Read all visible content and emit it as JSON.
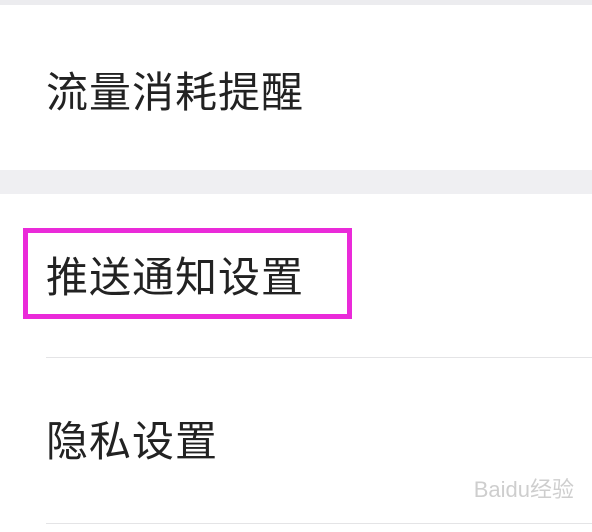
{
  "settings": {
    "items": [
      {
        "label": "流量消耗提醒"
      },
      {
        "label": "推送通知设置"
      },
      {
        "label": "隐私设置"
      }
    ]
  },
  "watermark": {
    "text": "Baidu经验"
  },
  "colors": {
    "highlight": "#ea2ad9",
    "section_gap": "#efeff2",
    "text": "#222222"
  }
}
